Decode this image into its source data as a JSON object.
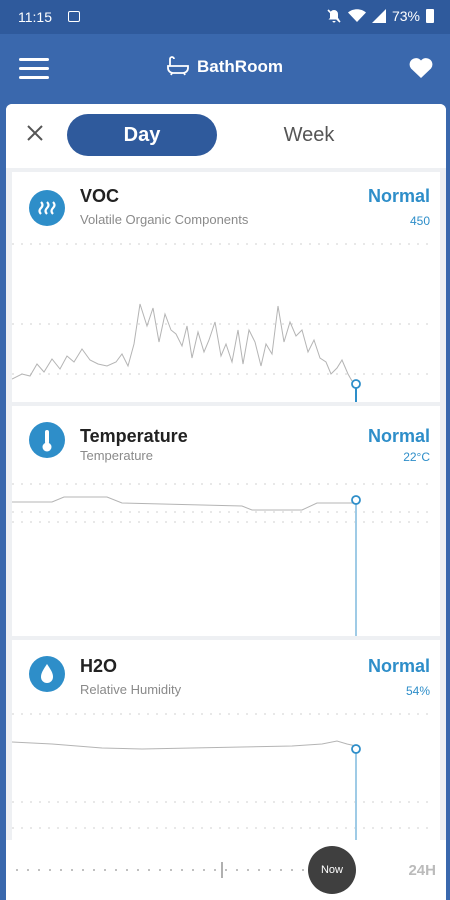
{
  "status_bar": {
    "time": "11:15",
    "battery": "73%"
  },
  "app_bar": {
    "title": "BathRoom"
  },
  "tabs": {
    "day": "Day",
    "week": "Week"
  },
  "sensors": [
    {
      "name": "VOC",
      "subtitle": "Volatile Organic Components",
      "status": "Normal",
      "value": "450"
    },
    {
      "name": "Temperature",
      "subtitle": "Temperature",
      "status": "Normal",
      "value": "22°C"
    },
    {
      "name": "H2O",
      "subtitle": "Relative Humidity",
      "status": "Normal",
      "value": "54%"
    }
  ],
  "timeline": {
    "now_label": "Now",
    "range_label": "24H"
  },
  "colors": {
    "primary": "#3a68ad",
    "dark_primary": "#2f5a9c",
    "accent": "#2e8ec9",
    "warning": "#f0a64a",
    "danger": "#d91e2e"
  }
}
